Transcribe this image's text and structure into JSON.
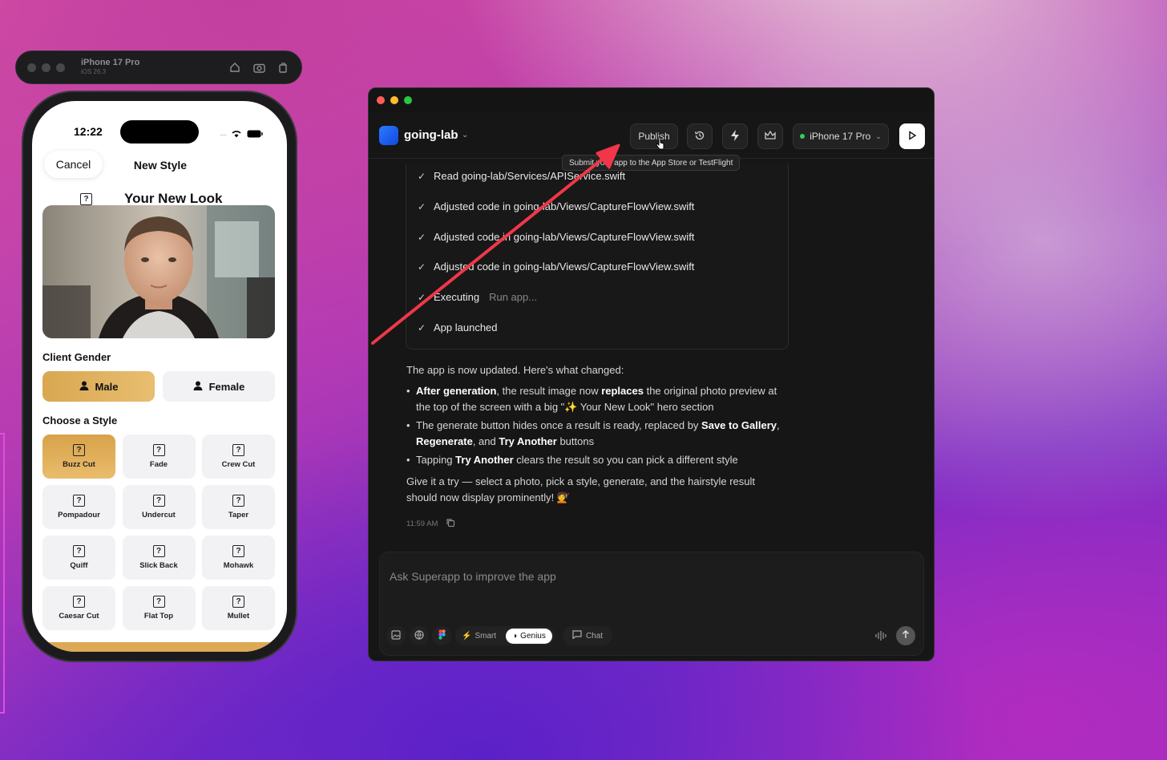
{
  "simulator": {
    "device": "iPhone 17 Pro",
    "os": "iOS 26.3"
  },
  "phone": {
    "time": "12:22",
    "cancel": "Cancel",
    "nav_title": "New Style",
    "look_title": "Your New Look",
    "gender_label": "Client Gender",
    "gender_male": "Male",
    "gender_female": "Female",
    "style_label": "Choose a Style",
    "styles": [
      "Buzz Cut",
      "Fade",
      "Crew Cut",
      "Pompadour",
      "Undercut",
      "Taper",
      "Quiff",
      "Slick Back",
      "Mohawk",
      "Caesar Cut",
      "Flat Top",
      "Mullet"
    ],
    "icon_glyph": "?"
  },
  "app": {
    "project": "going-lab",
    "publish": "Publish",
    "tooltip": "Submit your app to the App Store or TestFlight",
    "device": "iPhone 17 Pro",
    "steps": [
      "Read going-lab/Services/APIService.swift",
      "Adjusted code in going-lab/Views/CaptureFlowView.swift",
      "Adjusted code in going-lab/Views/CaptureFlowView.swift",
      "Adjusted code in going-lab/Views/CaptureFlowView.swift"
    ],
    "executing": "Executing",
    "executing_sub": "Run app...",
    "launched": "App launched",
    "intro": "The app is now updated. Here's what changed:",
    "b1_bold1": "After generation",
    "b1_t1": ", the result image now ",
    "b1_bold2": "replaces",
    "b1_t2": " the original photo preview at the top of the screen with a big \"✨ Your New Look\" hero section",
    "b2_t1": "The generate button hides once a result is ready, replaced by ",
    "b2_bold1": "Save to Gallery",
    "b2_t2": ", ",
    "b2_bold2": "Regenerate",
    "b2_t3": ", and ",
    "b2_bold3": "Try Another",
    "b2_t4": " buttons",
    "b3_t1": "Tapping ",
    "b3_bold1": "Try Another",
    "b3_t2": " clears the result so you can pick a different style",
    "closing": "Give it a try — select a photo, pick a style, generate, and the hairstyle result should now display prominently! 💇",
    "timestamp": "11:59 AM",
    "input_placeholder": "Ask Superapp to improve the app",
    "mode_smart": "Smart",
    "mode_genius": "Genius",
    "mode_chat": "Chat"
  },
  "colors": {
    "accent_gold": "#e0ae5c",
    "annotation_arrow": "#f0374a",
    "status_green": "#30d158"
  }
}
